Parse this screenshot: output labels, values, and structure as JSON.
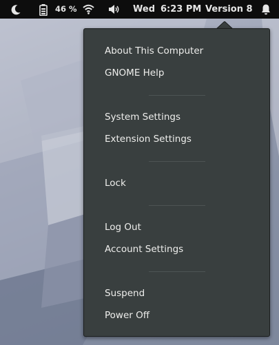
{
  "topbar": {
    "battery_percent": "46 %",
    "day": "Wed",
    "time": "6:23 PM",
    "version_label": "Version 8",
    "icons": [
      "moon-icon",
      "battery-icon",
      "wifi-icon",
      "volume-icon",
      "bell-icon"
    ]
  },
  "system_menu": {
    "groups": [
      [
        "About This Computer",
        "GNOME Help"
      ],
      [
        "System Settings",
        "Extension Settings"
      ],
      [
        "Lock"
      ],
      [
        "Log Out",
        "Account Settings"
      ],
      [
        "Suspend",
        "Power Off"
      ]
    ]
  },
  "colors": {
    "topbar_bg": "#0d0d0d",
    "menu_bg": "#393f3f",
    "menu_text": "#eeeeec"
  }
}
